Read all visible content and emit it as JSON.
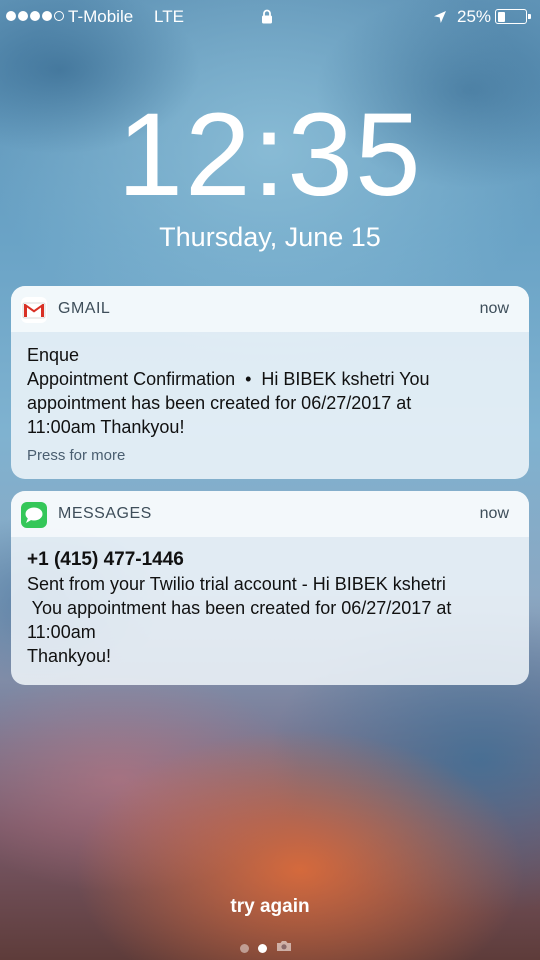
{
  "status_bar": {
    "signal_bars_filled": 4,
    "signal_bars_total": 5,
    "carrier": "T-Mobile",
    "network": "LTE",
    "battery_percent": "25%",
    "battery_level": 0.25,
    "icons": [
      "lock-icon",
      "location-arrow-icon",
      "battery-icon"
    ]
  },
  "lock_screen": {
    "time": "12:35",
    "date": "Thursday, June 15"
  },
  "notifications": [
    {
      "app": "GMAIL",
      "icon": "gmail-icon",
      "time": "now",
      "lines": [
        "Enque",
        "Appointment Confirmation  •  Hi BIBEK kshetri You",
        "appointment has been created for 06/27/2017 at",
        "11:00am Thankyou!"
      ],
      "action": "Press for more"
    },
    {
      "app": "MESSAGES",
      "icon": "messages-icon",
      "time": "now",
      "sender": "+1 (415) 477-1446",
      "lines": [
        "Sent from your Twilio trial account - Hi BIBEK kshetri",
        " You appointment has been created for 06/27/2017 at",
        "11:00am",
        "Thankyou!"
      ]
    }
  ],
  "bottom": {
    "hint": "try again",
    "pages": 3,
    "active_page": 2,
    "camera_icon": "camera-icon"
  },
  "colors": {
    "messages_green": "#34c759",
    "gmail_red": "#d93025"
  }
}
